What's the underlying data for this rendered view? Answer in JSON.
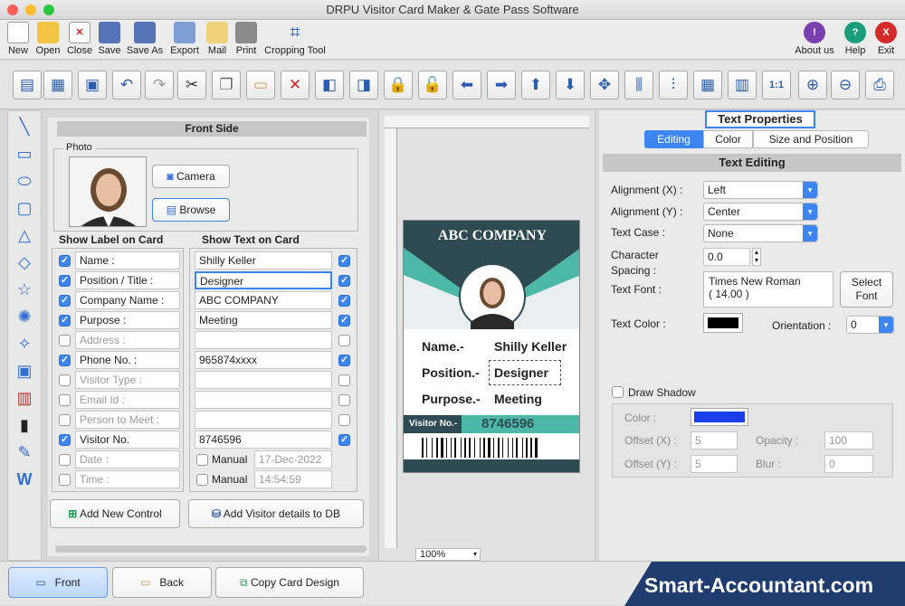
{
  "window": {
    "title": "DRPU Visitor Card Maker & Gate Pass Software"
  },
  "menu": {
    "new": "New",
    "open": "Open",
    "close": "Close",
    "save": "Save",
    "save_as": "Save As",
    "export": "Export",
    "mail": "Mail",
    "print": "Print",
    "cropping_tool": "Cropping Tool",
    "about_us": "About us",
    "help": "Help",
    "exit": "Exit"
  },
  "front_side": {
    "title": "Front Side",
    "photo_label": "Photo",
    "camera_label": "Camera",
    "browse_label": "Browse",
    "show_label_header": "Show Label on Card",
    "show_text_header": "Show Text on Card",
    "rows": [
      {
        "label": "Name :",
        "text": "Shilly Keller",
        "label_on": true,
        "text_on": true
      },
      {
        "label": "Position / Title :",
        "text": "Designer",
        "label_on": true,
        "text_on": true
      },
      {
        "label": "Company Name :",
        "text": "ABC COMPANY",
        "label_on": true,
        "text_on": true
      },
      {
        "label": "Purpose :",
        "text": "Meeting",
        "label_on": true,
        "text_on": true
      },
      {
        "label": "Address :",
        "text": "",
        "label_on": false,
        "text_on": false
      },
      {
        "label": "Phone No. :",
        "text": "965874xxxx",
        "label_on": true,
        "text_on": true
      },
      {
        "label": "Visitor Type :",
        "text": "",
        "label_on": false,
        "text_on": false
      },
      {
        "label": "Email Id :",
        "text": "",
        "label_on": false,
        "text_on": false
      },
      {
        "label": "Person to Meet :",
        "text": "",
        "label_on": false,
        "text_on": false
      },
      {
        "label": "Visitor No.",
        "text": "8746596",
        "label_on": true,
        "text_on": true
      },
      {
        "label": "Date :",
        "text": "",
        "label_on": false,
        "text_on": false
      },
      {
        "label": "Time :",
        "text": "",
        "label_on": false,
        "text_on": false
      }
    ],
    "date_manual": "Manual",
    "date_value": "17-Dec-2022",
    "time_manual": "Manual",
    "time_value": "14:54:59",
    "add_control_label": "Add New Control",
    "add_db_label": "Add Visitor details to DB"
  },
  "card": {
    "company": "ABC COMPANY",
    "name_label": "Name.-",
    "name_value": "Shilly Keller",
    "position_label": "Position.-",
    "position_value": "Designer",
    "purpose_label": "Purpose.-",
    "purpose_value": "Meeting",
    "visitor_label": "Visitor No.-",
    "visitor_value": "8746596",
    "accent": "#4cb8a8",
    "dark": "#2e4a52"
  },
  "canvas": {
    "zoom": "100%"
  },
  "text_properties": {
    "title": "Text Properties",
    "tabs": [
      "Editing",
      "Color",
      "Size and Position"
    ],
    "section": "Text Editing",
    "alignment_x_label": "Alignment (X) :",
    "alignment_x": "Left",
    "alignment_y_label": "Alignment (Y) :",
    "alignment_y": "Center",
    "text_case_label": "Text Case :",
    "text_case": "None",
    "char_spacing_label_1": "Character",
    "char_spacing_label_2": "Spacing :",
    "char_spacing": "0.0",
    "text_font_label": "Text Font :",
    "font_name": "Times New Roman",
    "font_size": "( 14.00 )",
    "select_font_1": "Select",
    "select_font_2": "Font",
    "text_color_label": "Text Color :",
    "text_color": "#000000",
    "orientation_label": "Orientation :",
    "orientation": "0",
    "draw_shadow": "Draw Shadow",
    "shadow_color_label": "Color :",
    "shadow_color": "#1a3ee8",
    "offset_x_label": "Offset (X) :",
    "offset_x": "5",
    "offset_y_label": "Offset (Y) :",
    "offset_y": "5",
    "opacity_label": "Opacity :",
    "opacity": "100",
    "blur_label": "Blur :",
    "blur": "0"
  },
  "bottom": {
    "front": "Front",
    "back": "Back",
    "copy": "Copy Card Design",
    "brand": "Smart-Accountant.com"
  }
}
